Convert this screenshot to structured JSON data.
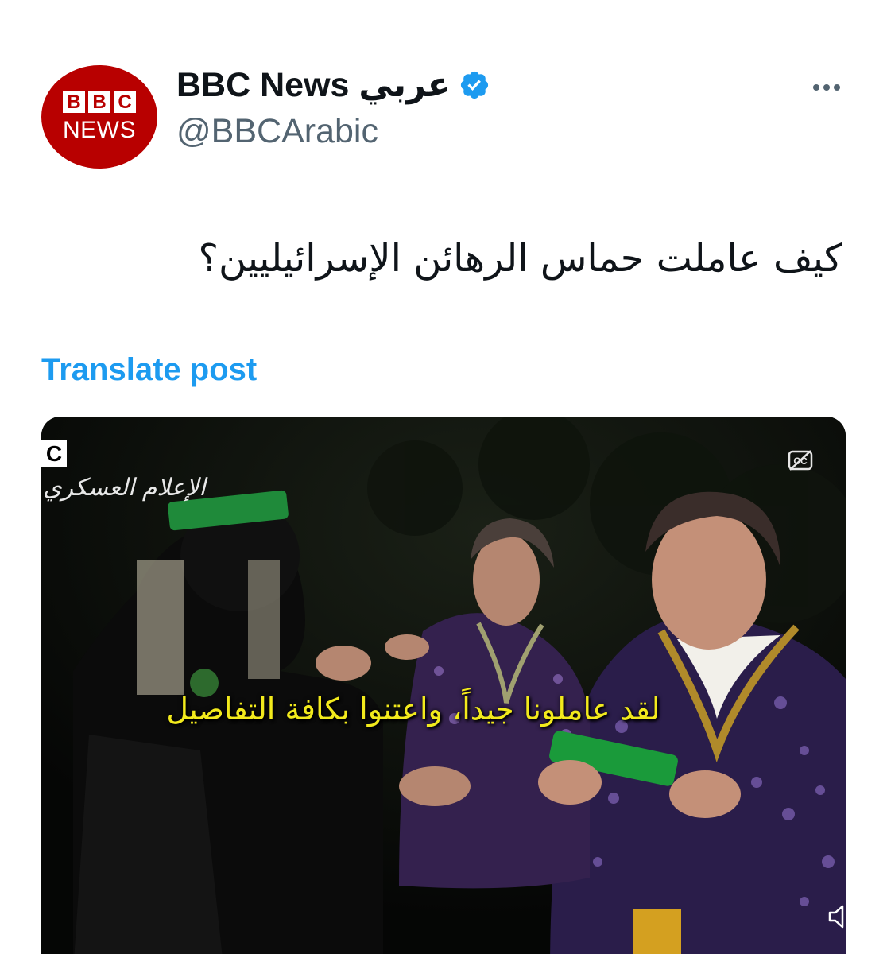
{
  "tweet": {
    "display_name": "BBC News عربي",
    "handle": "@BBCArabic",
    "avatar": {
      "brand_letters": [
        "B",
        "B",
        "C"
      ],
      "word": "NEWS",
      "color": "#b80000"
    },
    "verified_icon": "verified-badge-icon",
    "more_icon": "more-options-icon",
    "text": "كيف عاملت حماس الرهائن الإسرائيليين؟",
    "translate_label": "Translate post",
    "translate_color": "#1d9bf0"
  },
  "media": {
    "corner_logo": "C",
    "watermark": "الإعلام العسكري",
    "subtitle": "لقد عاملونا جيداً، واعتنوا بكافة التفاصيل",
    "subtitle_color": "#f2ea1c",
    "cc_icon": "closed-captions-icon",
    "mute_icon": "muted-speaker-icon"
  }
}
